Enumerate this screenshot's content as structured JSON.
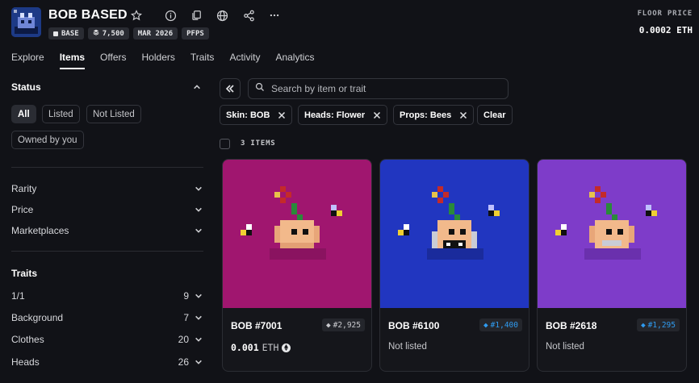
{
  "collection": {
    "title": "BOB BASED",
    "chips": [
      {
        "icon": "base-chain-icon",
        "label": "BASE"
      },
      {
        "icon": "stack-icon",
        "label": "7,500"
      },
      {
        "icon": "",
        "label": "MAR 2026"
      },
      {
        "icon": "",
        "label": "PFPS"
      }
    ],
    "floor_label": "FLOOR PRICE",
    "floor_value": "0.0002 ETH"
  },
  "header_icons": [
    "star-icon",
    "info-icon",
    "copy-icon",
    "globe-icon",
    "share-icon",
    "more-icon"
  ],
  "tabs": [
    {
      "label": "Explore",
      "active": false
    },
    {
      "label": "Items",
      "active": true
    },
    {
      "label": "Offers",
      "active": false
    },
    {
      "label": "Holders",
      "active": false
    },
    {
      "label": "Traits",
      "active": false
    },
    {
      "label": "Activity",
      "active": false
    },
    {
      "label": "Analytics",
      "active": false
    }
  ],
  "sidebar": {
    "status_title": "Status",
    "status_options": [
      {
        "label": "All",
        "active": true
      },
      {
        "label": "Listed",
        "active": false
      },
      {
        "label": "Not Listed",
        "active": false
      },
      {
        "label": "Owned by you",
        "active": false
      }
    ],
    "sections": [
      "Rarity",
      "Price",
      "Marketplaces"
    ],
    "traits_title": "Traits",
    "traits": [
      {
        "label": "1/1",
        "count": "9"
      },
      {
        "label": "Background",
        "count": "7"
      },
      {
        "label": "Clothes",
        "count": "20"
      },
      {
        "label": "Heads",
        "count": "26"
      }
    ]
  },
  "search": {
    "placeholder": "Search by item or trait"
  },
  "filters": [
    "Skin: BOB",
    "Heads: Flower",
    "Props: Bees"
  ],
  "clear_label": "Clear",
  "items_count": "3 ITEMS",
  "colors": {
    "accent_blue": "#2f9bf0",
    "card1_bg": "#a0166f",
    "card2_bg": "#2136c0",
    "card3_bg": "#7e3cc9"
  },
  "cards": [
    {
      "name": "BOB #7001",
      "rank": "#2,925",
      "rank_color": "#c9cace",
      "status": "0.001",
      "status_unit": "ETH",
      "bg": "#a0166f"
    },
    {
      "name": "BOB #6100",
      "rank": "#1,400",
      "rank_color": "#2f9bf0",
      "status": "Not listed",
      "status_unit": "",
      "bg": "#2136c0"
    },
    {
      "name": "BOB #2618",
      "rank": "#1,295",
      "rank_color": "#2f9bf0",
      "status": "Not listed",
      "status_unit": "",
      "bg": "#7e3cc9"
    }
  ]
}
